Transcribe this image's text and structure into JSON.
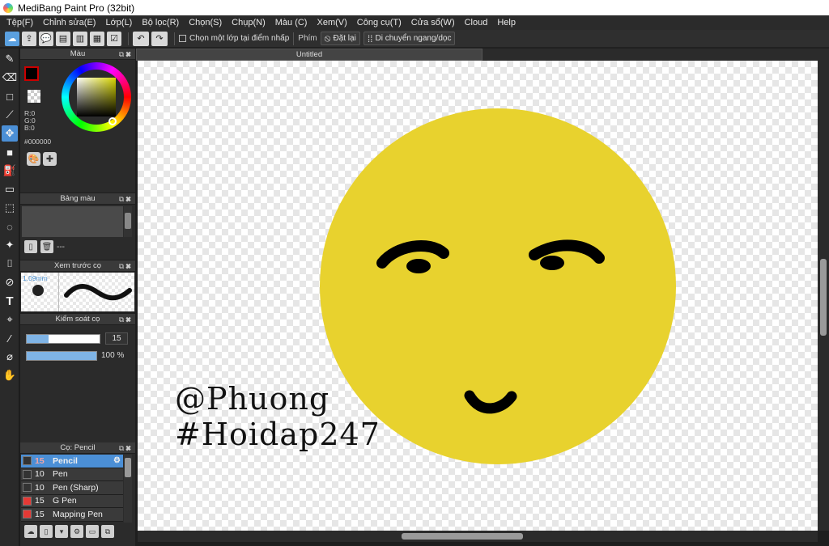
{
  "window": {
    "title": "MediBang Paint Pro (32bit)"
  },
  "menu": [
    "Tệp(F)",
    "Chỉnh sửa(E)",
    "Lớp(L)",
    "Bộ lọc(R)",
    "Chọn(S)",
    "Chụp(N)",
    "Màu (C)",
    "Xem(V)",
    "Công cụ(T)",
    "Cửa sổ(W)",
    "Cloud",
    "Help"
  ],
  "toolbar": {
    "snap_checkbox_label": "Chọn một lớp tại điểm nhấp",
    "snap_label": "Phím",
    "reset_label": "Đặt lại",
    "move_label": "Di chuyển ngang/dọc"
  },
  "color_panel": {
    "title": "Màu",
    "r": "R:0",
    "g": "G:0",
    "b": "B:0",
    "hex": "#000000",
    "fg_color": "#000000",
    "bg_color": "#ffffff"
  },
  "palette_panel": {
    "title": "Bảng màu",
    "empty_label": "---"
  },
  "brush_preview": {
    "title": "Xem trước cọ",
    "size": "1.09mm"
  },
  "brush_control": {
    "title": "Kiểm soát cọ",
    "size_value": "15",
    "size_fraction": 0.3,
    "opacity_value": "100 %",
    "opacity_fraction": 1.0
  },
  "brush_panel": {
    "title": "Cọ: Pencil",
    "items": [
      {
        "size": "15",
        "name": "Pencil",
        "color": "#333333",
        "selected": true
      },
      {
        "size": "10",
        "name": "Pen",
        "color": "#333333",
        "selected": false
      },
      {
        "size": "10",
        "name": "Pen (Sharp)",
        "color": "#333333",
        "selected": false
      },
      {
        "size": "15",
        "name": "G Pen",
        "color": "#e53935",
        "selected": false
      },
      {
        "size": "15",
        "name": "Mapping Pen",
        "color": "#e53935",
        "selected": false
      }
    ]
  },
  "document": {
    "tab_title": "Untitled",
    "caption_line1": "@Phuong",
    "caption_line2": "#Hoidap247",
    "face_color": "#e8d22e"
  }
}
